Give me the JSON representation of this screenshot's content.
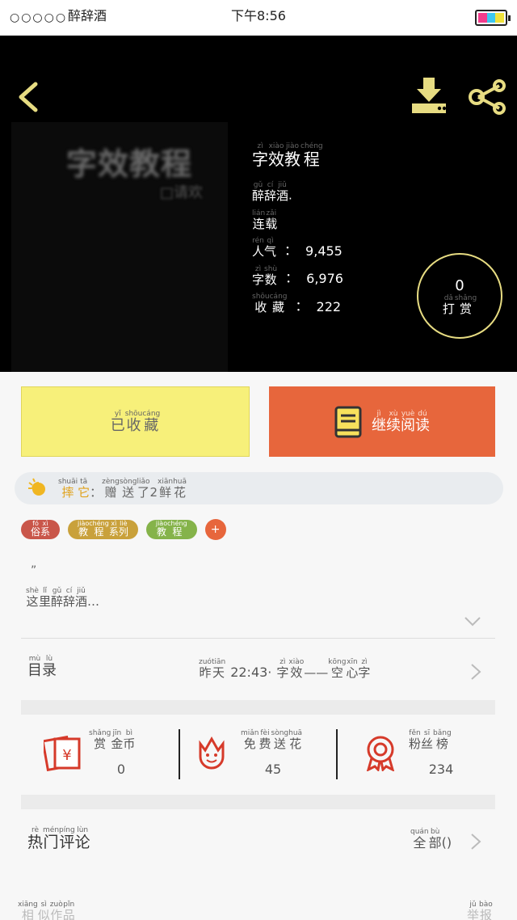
{
  "status_bar": {
    "signal": "○○○○○",
    "carrier": "醉辞酒",
    "time": "下午8:56"
  },
  "book": {
    "title": {
      "chars": [
        "字",
        "效",
        "教",
        "程"
      ],
      "pinyin": [
        "zì",
        "xiào",
        "jiào",
        "chéng"
      ]
    },
    "author": {
      "chars": [
        "醉",
        "辞",
        "酒"
      ],
      "pinyin": [
        "gǔ",
        "cí",
        "jiǔ"
      ],
      "suffix": "."
    },
    "state": {
      "chars": [
        "连",
        "载"
      ],
      "pinyin": [
        "lián",
        "zǎi"
      ]
    },
    "popularity": {
      "chars": [
        "人",
        "气"
      ],
      "pinyin": [
        "rén",
        "qì"
      ],
      "value": "9,455"
    },
    "word_count": {
      "chars": [
        "字",
        "数"
      ],
      "pinyin": [
        "zì",
        "shù"
      ],
      "value": "6,976"
    },
    "favorites": {
      "chars": [
        "收",
        "藏"
      ],
      "pinyin": [
        "shōu",
        "cáng"
      ],
      "value": "222"
    },
    "cover": {
      "title": "字效教程",
      "subtitle": "□请欢"
    }
  },
  "reward": {
    "count": "0",
    "label": {
      "chars": [
        "打",
        "赏"
      ],
      "pinyin": [
        "dǎ",
        "shǎng"
      ]
    }
  },
  "actions": {
    "favorited": {
      "chars": [
        "已",
        "收",
        "藏"
      ],
      "pinyin": [
        "yǐ",
        "shōu",
        "cáng"
      ]
    },
    "continue": {
      "chars": [
        "继",
        "续",
        "阅",
        "读"
      ],
      "pinyin": [
        "jì",
        "xù",
        "yuè",
        "dú"
      ]
    }
  },
  "notice": {
    "user": {
      "chars": [
        "摔",
        "它"
      ],
      "pinyin": [
        "shuāi",
        "tā"
      ]
    },
    "rest": {
      "chars": [
        "：",
        "赠",
        "送",
        "了",
        "2",
        "鲜",
        "花"
      ],
      "pinyin": [
        "",
        "zèng",
        "sòng",
        "liǎo",
        "",
        "xiān",
        "huā"
      ]
    }
  },
  "tags": [
    {
      "chars": [
        "俗",
        "系"
      ],
      "pinyin": [
        "fó",
        "xì"
      ],
      "color": "#c9564a"
    },
    {
      "chars": [
        "教",
        "程",
        "系",
        "列"
      ],
      "pinyin": [
        "jiào",
        "chéng",
        "xì",
        "liè"
      ],
      "color": "#c9a13b"
    },
    {
      "chars": [
        "教",
        "程"
      ],
      "pinyin": [
        "jiào",
        "chéng"
      ],
      "color": "#85b34a"
    }
  ],
  "tag_add": "+",
  "description": {
    "quote": "”",
    "chars": [
      "这",
      "里",
      "醉",
      "辞",
      "酒",
      "…"
    ],
    "pinyin": [
      "shè",
      "lǐ",
      "gǔ",
      "cí",
      "jiǔ",
      ""
    ]
  },
  "catalog": {
    "label": {
      "chars": [
        "目",
        "录"
      ],
      "pinyin": [
        "mù",
        "lù"
      ]
    },
    "when": {
      "chars": [
        "昨",
        "天"
      ],
      "pinyin": [
        "zuó",
        "tiān"
      ]
    },
    "time": "22:43·",
    "latest": {
      "chars": [
        "字",
        "效",
        "—",
        "—",
        "空",
        "心",
        "字"
      ],
      "pinyin": [
        "zì",
        "xiào",
        "",
        "",
        "kōng",
        "xīn",
        "zì"
      ]
    }
  },
  "stats": [
    {
      "chars": [
        "赏",
        "金",
        "币"
      ],
      "pinyin": [
        "shǎng",
        "jīn",
        "bì"
      ],
      "value": "0",
      "icon": "red-envelope-icon"
    },
    {
      "chars": [
        "免",
        "费",
        "送",
        "花"
      ],
      "pinyin": [
        "miǎn",
        "fèi",
        "sòng",
        "huā"
      ],
      "value": "45",
      "icon": "flower-icon"
    },
    {
      "chars": [
        "粉",
        "丝",
        "榜"
      ],
      "pinyin": [
        "fěn",
        "sī",
        "bǎng"
      ],
      "value": "234",
      "icon": "medal-icon"
    }
  ],
  "comments": {
    "label": {
      "chars": [
        "热",
        "门",
        "评",
        "论"
      ],
      "pinyin": [
        "rè",
        "mén",
        "píng",
        "lùn"
      ]
    },
    "all": {
      "chars": [
        "全",
        "部"
      ],
      "pinyin": [
        "quán",
        "bù"
      ],
      "suffix": "()"
    }
  },
  "footer": {
    "similar": {
      "chars": [
        "相",
        "似",
        "作",
        "品"
      ],
      "pinyin": [
        "xiāng",
        "sì",
        "zuò",
        "pǐn"
      ]
    },
    "report": {
      "chars": [
        "举",
        "报"
      ],
      "pinyin": [
        "jǔ",
        "bào"
      ]
    }
  },
  "colors": {
    "accent_yellow": "#f7f07a",
    "accent_orange": "#e7663c",
    "icon_gold": "#e7dc82",
    "icon_red": "#d63a2a"
  }
}
